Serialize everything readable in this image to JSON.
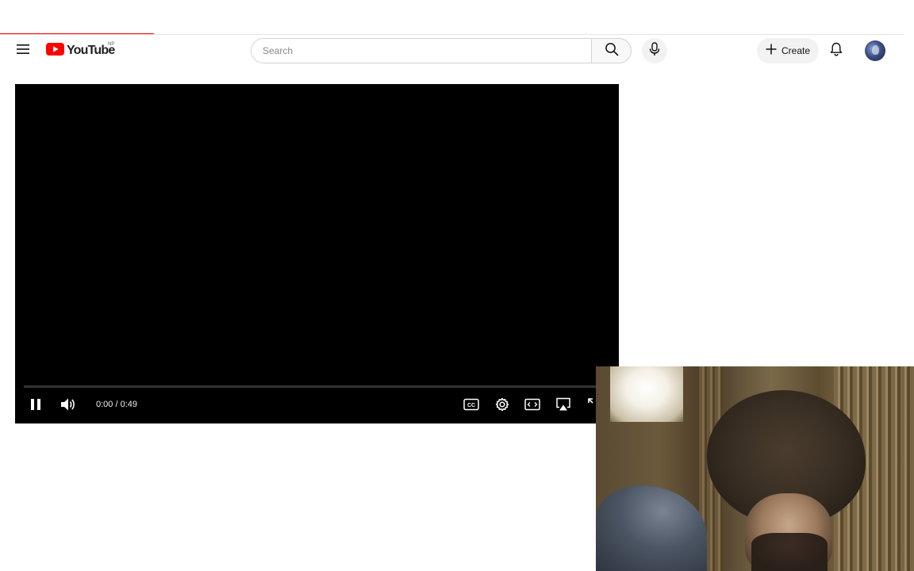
{
  "masthead": {
    "logo_text": "YouTube",
    "country_code": "NP",
    "search": {
      "placeholder": "Search",
      "value": ""
    },
    "create_label": "Create",
    "icons": {
      "menu": "hamburger-menu-icon",
      "search": "search-icon",
      "mic": "microphone-icon",
      "create": "plus-icon",
      "notifications": "bell-icon",
      "avatar": "user-avatar"
    }
  },
  "player": {
    "time_current": "0:00",
    "time_separator": "/",
    "time_total": "0:49",
    "progress_fraction": 0.0,
    "controls": [
      "pause-icon",
      "volume-icon",
      "subtitles-icon",
      "settings-icon",
      "miniplayer-icon",
      "airplay-icon",
      "fullscreen-icon"
    ]
  },
  "page_load_progress_fraction": 0.17,
  "colors": {
    "brand_red": "#FF0000",
    "player_background": "#000000",
    "page_background": "#FFFFFF"
  }
}
